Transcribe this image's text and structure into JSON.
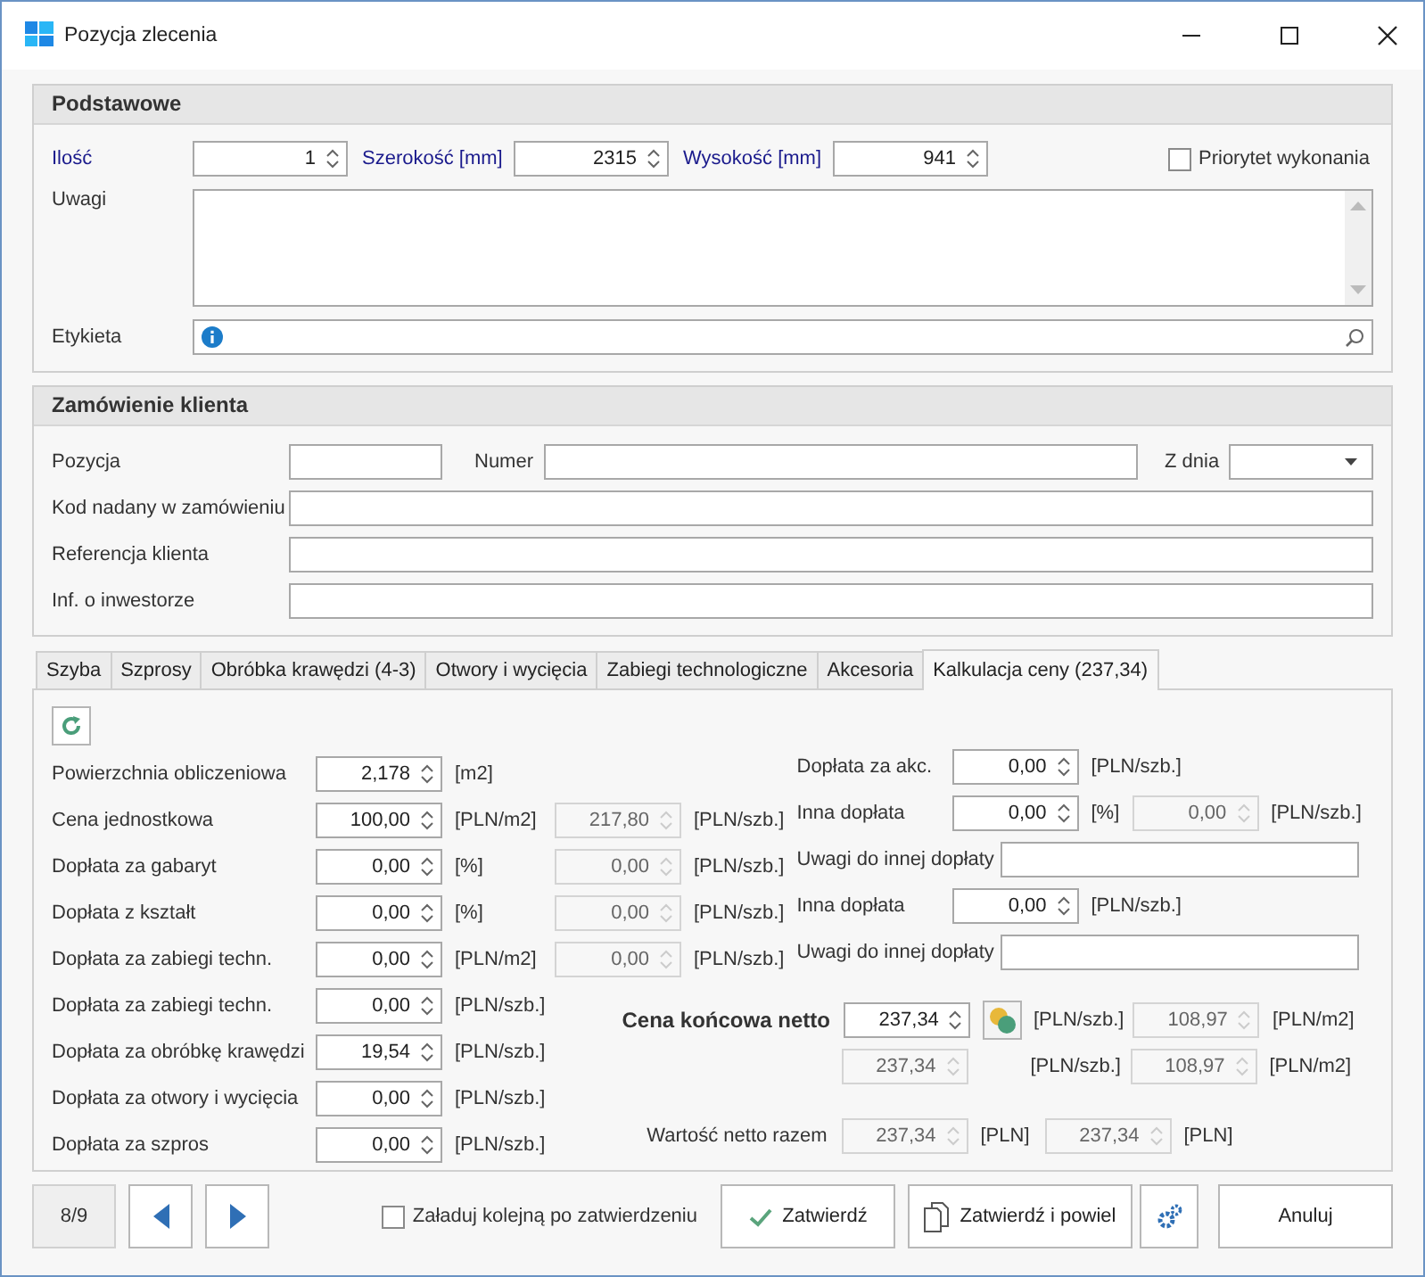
{
  "window": {
    "title": "Pozycja zlecenia"
  },
  "basic": {
    "title": "Podstawowe",
    "spins": [
      {
        "label": "Ilość",
        "value": "1",
        "required": true
      },
      {
        "label": "Szerokość [mm]",
        "value": "2315",
        "required": true
      },
      {
        "label": "Wysokość [mm]",
        "value": "941",
        "required": true
      }
    ],
    "priority": {
      "label": "Priorytet wykonania",
      "checked": false
    },
    "notes": {
      "label": "Uwagi"
    },
    "tag": {
      "label": "Etykieta"
    }
  },
  "client_order": {
    "title": "Zamówienie klienta",
    "position": {
      "label": "Pozycja"
    },
    "number": {
      "label": "Numer"
    },
    "date": {
      "label": "Z dnia"
    },
    "fields": [
      {
        "label": "Kod nadany w zamówieniu"
      },
      {
        "label": "Referencja klienta"
      },
      {
        "label": "Inf. o inwestorze"
      }
    ]
  },
  "tabs": [
    {
      "label": "Szyba",
      "selected": false
    },
    {
      "label": "Szprosy",
      "selected": false
    },
    {
      "label": "Obróbka krawędzi (4-3)",
      "selected": false
    },
    {
      "label": "Otwory i wycięcia",
      "selected": false
    },
    {
      "label": "Zabiegi technologiczne",
      "selected": false
    },
    {
      "label": "Akcesoria",
      "selected": false
    },
    {
      "label": "Kalkulacja ceny (237,34)",
      "selected": true
    }
  ],
  "calc": {
    "left_rows": [
      {
        "label": "Powierzchnia obliczeniowa",
        "value": "2,178",
        "unit": "[m2]"
      },
      {
        "label": "Cena jednostkowa",
        "value": "100,00",
        "unit": "[PLN/m2]",
        "derived": {
          "value": "217,80",
          "unit": "[PLN/szb.]",
          "disabled": true
        }
      },
      {
        "label": "Dopłata za gabaryt",
        "value": "0,00",
        "unit": "[%]",
        "derived": {
          "value": "0,00",
          "unit": "[PLN/szb.]",
          "disabled": true
        }
      },
      {
        "label": "Dopłata z kształt",
        "value": "0,00",
        "unit": "[%]",
        "derived": {
          "value": "0,00",
          "unit": "[PLN/szb.]",
          "disabled": true
        }
      },
      {
        "label": "Dopłata za zabiegi techn.",
        "value": "0,00",
        "unit": "[PLN/m2]",
        "derived": {
          "value": "0,00",
          "unit": "[PLN/szb.]",
          "disabled": true
        }
      },
      {
        "label": "Dopłata za zabiegi techn.",
        "value": "0,00",
        "unit": "[PLN/szb.]"
      },
      {
        "label": "Dopłata za obróbkę krawędzi",
        "value": "19,54",
        "unit": "[PLN/szb.]"
      },
      {
        "label": "Dopłata za otwory i wycięcia",
        "value": "0,00",
        "unit": "[PLN/szb.]"
      },
      {
        "label": "Dopłata za szpros",
        "value": "0,00",
        "unit": "[PLN/szb.]"
      }
    ],
    "right_rows": [
      {
        "kind": "spin",
        "label": "Dopłata za akc.",
        "value": "0,00",
        "unit": "[PLN/szb.]"
      },
      {
        "kind": "spin",
        "label": "Inna dopłata",
        "value": "0,00",
        "unit": "[%]",
        "derived": {
          "value": "0,00",
          "unit": "[PLN/szb.]",
          "disabled": true
        }
      },
      {
        "kind": "text",
        "label": "Uwagi do innej dopłaty"
      },
      {
        "kind": "spin",
        "label": "Inna dopłata",
        "value": "0,00",
        "unit": "[PLN/szb.]"
      },
      {
        "kind": "text",
        "label": "Uwagi do innej dopłaty"
      }
    ],
    "final_price": {
      "label": "Cena końcowa netto",
      "value": "237,34",
      "unit": "[PLN/szb.]",
      "derived": {
        "value": "108,97",
        "unit": "[PLN/m2]",
        "disabled": true
      }
    },
    "final_price_2": {
      "value": "237,34",
      "disabled": true,
      "unit": "[PLN/szb.]",
      "derived": {
        "value": "108,97",
        "unit": "[PLN/m2]",
        "disabled": true
      }
    },
    "total": {
      "label": "Wartość netto razem",
      "value": "237,34",
      "disabled": true,
      "unit": "[PLN]",
      "value_2": "237,34",
      "unit_2": "[PLN]"
    }
  },
  "footer": {
    "counter": "8/9",
    "load_next": {
      "label": "Załaduj kolejną po zatwierdzeniu",
      "checked": false
    },
    "confirm": "Zatwierdź",
    "confirm_copy": "Zatwierdź i powiel",
    "cancel": "Anuluj"
  }
}
